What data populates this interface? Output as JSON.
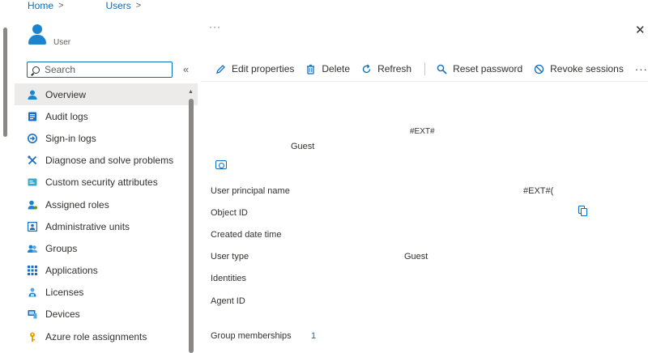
{
  "breadcrumb": {
    "home": "Home",
    "sep1": ">",
    "users": "Users",
    "sep2": ">"
  },
  "header": {
    "subtitle": "User",
    "more": "···",
    "close": "✕"
  },
  "search": {
    "placeholder": "Search",
    "collapse": "«"
  },
  "nav": {
    "items": [
      {
        "label": "Overview",
        "icon": "user-icon",
        "active": true
      },
      {
        "label": "Audit logs",
        "icon": "audit-logs-icon"
      },
      {
        "label": "Sign-in logs",
        "icon": "sign-in-logs-icon"
      },
      {
        "label": "Diagnose and solve problems",
        "icon": "diagnose-icon"
      },
      {
        "label": "Custom security attributes",
        "icon": "security-attributes-icon"
      },
      {
        "label": "Assigned roles",
        "icon": "assigned-roles-icon"
      },
      {
        "label": "Administrative units",
        "icon": "administrative-units-icon"
      },
      {
        "label": "Groups",
        "icon": "groups-icon"
      },
      {
        "label": "Applications",
        "icon": "applications-icon"
      },
      {
        "label": "Licenses",
        "icon": "licenses-icon"
      },
      {
        "label": "Devices",
        "icon": "devices-icon"
      },
      {
        "label": "Azure role assignments",
        "icon": "key-icon"
      }
    ]
  },
  "toolbar": {
    "edit": "Edit properties",
    "delete": "Delete",
    "refresh": "Refresh",
    "reset_password": "Reset password",
    "revoke_sessions": "Revoke sessions",
    "more": "···"
  },
  "profile": {
    "ext_tag": "#EXT#",
    "guest": "Guest"
  },
  "properties": {
    "upn_label": "User principal name",
    "upn_value": "#EXT#(",
    "object_id_label": "Object ID",
    "created_label": "Created date time",
    "user_type_label": "User type",
    "user_type_value": "Guest",
    "identities_label": "Identities",
    "agent_id_label": "Agent ID",
    "group_memberships_label": "Group memberships",
    "group_memberships_value": "1"
  },
  "colors": {
    "accent": "#0f6cbd",
    "active_bg": "#edebe9",
    "text": "#323130"
  }
}
